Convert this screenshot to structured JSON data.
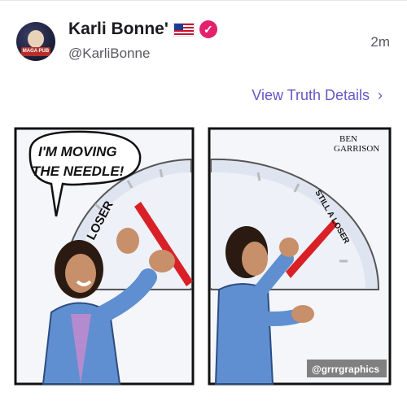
{
  "post": {
    "display_name": "Karli Bonne'",
    "handle": "@KarliBonne",
    "timestamp": "2m",
    "details_link": "View Truth Details",
    "avatar_label": "MAGA PUB"
  },
  "comic": {
    "panel1_speech": [
      "I'M MOVING",
      "THE NEEDLE!"
    ],
    "panel1_dial_label": "LOSER",
    "panel2_dial_label": "STILL A LOSER",
    "artist_signature": [
      "BEN",
      "GARRISON"
    ],
    "watermark": "@grrrgraphics"
  },
  "colors": {
    "accent": "#6558c8",
    "verified": "#e3206b",
    "needle": "#d92027",
    "dial": "#eef1f7"
  }
}
